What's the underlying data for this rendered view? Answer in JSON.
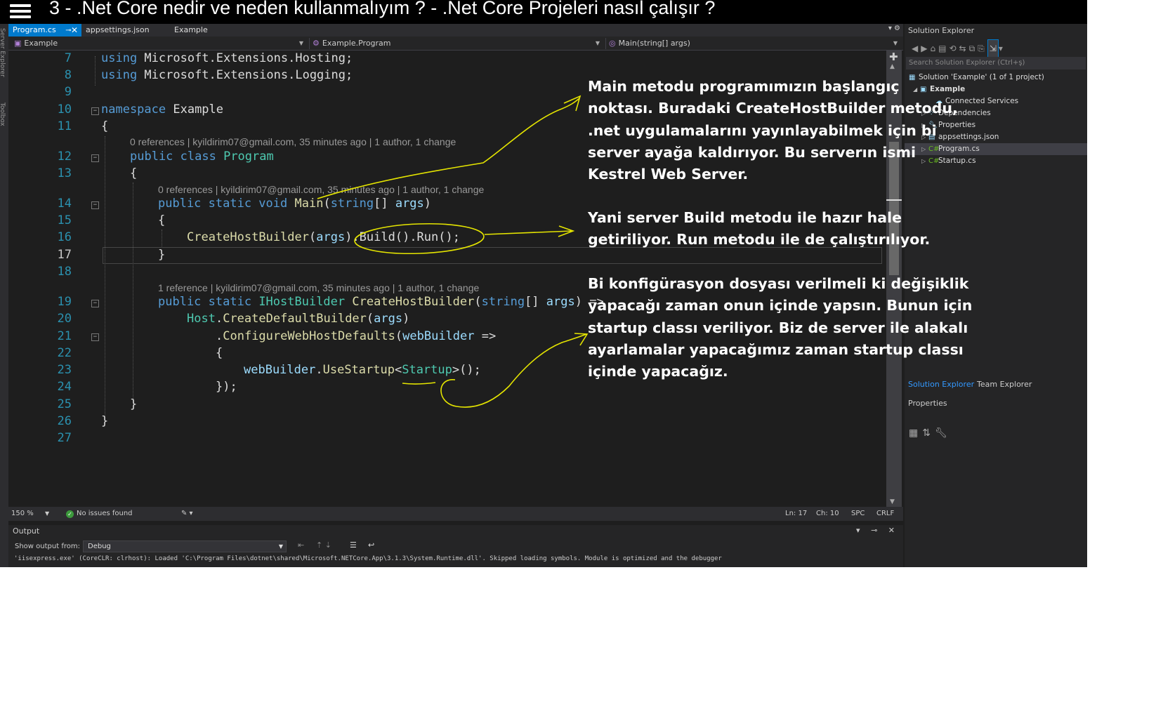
{
  "video": {
    "title": "3 - .Net Core nedir ve neden kullanmalıyım ? - .Net Core Projeleri nasıl çalışır ?"
  },
  "left_rail": {
    "labels": [
      "Server Explorer",
      "Toolbox"
    ]
  },
  "tabs": [
    {
      "label": "Program.cs",
      "active": true
    },
    {
      "label": "appsettings.json",
      "active": false
    },
    {
      "label": "Example",
      "active": false
    }
  ],
  "navbar": {
    "project": "Example",
    "class": "Example.Program",
    "member": "Main(string[] args)"
  },
  "editor": {
    "line_numbers": [
      "7",
      "8",
      "9",
      "10",
      "11",
      "12",
      "13",
      "14",
      "15",
      "16",
      "17",
      "18",
      "19",
      "20",
      "21",
      "22",
      "23",
      "24",
      "25",
      "26",
      "27"
    ],
    "code": {
      "l7_kw": "using",
      "l7_ns": " Microsoft.Extensions.Hosting;",
      "l8_kw": "using",
      "l8_ns": " Microsoft.Extensions.Logging;",
      "l10_kw": "namespace",
      "l10_name": " Example",
      "l11": "{",
      "l12_kw": "public class",
      "l12_name": "Program",
      "l13": "{",
      "l14_kw": "public static void",
      "l14_fn": "Main",
      "l14_open": "(",
      "l14_type": "string",
      "l14_rest": "[] ",
      "l14_param": "args",
      "l14_close": ")",
      "l15": "{",
      "l16_fn": "CreateHostBuilder",
      "l16_open": "(",
      "l16_param": "args",
      "l16_rest": ").Build().Run();",
      "l17": "}",
      "l19_kw": "public static",
      "l19_type": "IHostBuilder",
      "l19_fn": "CreateHostBuilder",
      "l19_open": "(",
      "l19_ptype": "string",
      "l19_rest": "[] ",
      "l19_param": "args",
      "l19_close": ") =>",
      "l20_cls": "Host",
      "l20_dot": ".",
      "l20_fn": "CreateDefaultBuilder",
      "l20_open": "(",
      "l20_param": "args",
      "l20_close": ")",
      "l21_dot": ".",
      "l21_fn": "ConfigureWebHostDefaults",
      "l21_open": "(",
      "l21_param": "webBuilder",
      "l21_arrow": " =>",
      "l22": "{",
      "l23_param": "webBuilder",
      "l23_dot": ".",
      "l23_fn": "UseStartup",
      "l23_lt": "<",
      "l23_type": "Startup",
      "l23_rest": ">();",
      "l24": "});",
      "l25": "}",
      "l26": "}"
    },
    "codelens": {
      "program": "0 references | kyildirim07@gmail.com, 35 minutes ago | 1 author, 1 change",
      "main": "0 references | kyildirim07@gmail.com, 35 minutes ago | 1 author, 1 change",
      "create": "1 reference | kyildirim07@gmail.com, 35 minutes ago | 1 author, 1 change"
    }
  },
  "annotations": {
    "block1": [
      "Main metodu programımızın başlangıç",
      "noktası. Buradaki CreateHostBuilder metodu,",
      ".net uygulamalarını yayınlayabilmek için bi",
      "server ayağa kaldırıyor. Bu serverın ismi",
      "Kestrel Web Server."
    ],
    "block2": [
      "Yani server Build metodu ile hazır hale",
      "getiriliyor. Run metodu ile de çalıştırılıyor."
    ],
    "block3": [
      "Bi konfigürasyon dosyası verilmeli ki değişiklik",
      "yapacağı zaman onun içinde yapsın. Bunun için",
      "startup classı veriliyor. Biz de server ile alakalı",
      "ayarlamalar yapacağımız zaman startup classı",
      "içinde yapacağız."
    ]
  },
  "status": {
    "zoom": "150 %",
    "issues": "No issues found",
    "line": "Ln: 17",
    "col": "Ch: 10",
    "spc": "SPC",
    "eol": "CRLF"
  },
  "output": {
    "title": "Output",
    "show_from_label": "Show output from:",
    "source": "Debug",
    "log": [
      "'iisexpress.exe' (CoreCLR: clrhost): Loaded 'C:\\Program Files\\dotnet\\shared\\Microsoft.NETCore.App\\3.1.3\\System.Runtime.dll'. Skipped loading symbols. Module is optimized and the debugger"
    ]
  },
  "solution_explorer": {
    "title": "Solution Explorer",
    "search_placeholder": "Search Solution Explorer (Ctrl+ş)",
    "solution": "Solution 'Example' (1 of 1 project)",
    "project": "Example",
    "items": [
      "Connected Services",
      "Dependencies",
      "Properties",
      "appsettings.json",
      "Program.cs",
      "Startup.cs"
    ],
    "selected": "Program.cs",
    "bottom_tabs": [
      "Solution Explorer",
      "Team Explorer"
    ],
    "properties_title": "Properties"
  },
  "colors": {
    "accent": "#007acc",
    "ink": "#e5e500",
    "keyword": "#569cd6",
    "type": "#4ec9b0",
    "line_number": "#2b91af"
  }
}
